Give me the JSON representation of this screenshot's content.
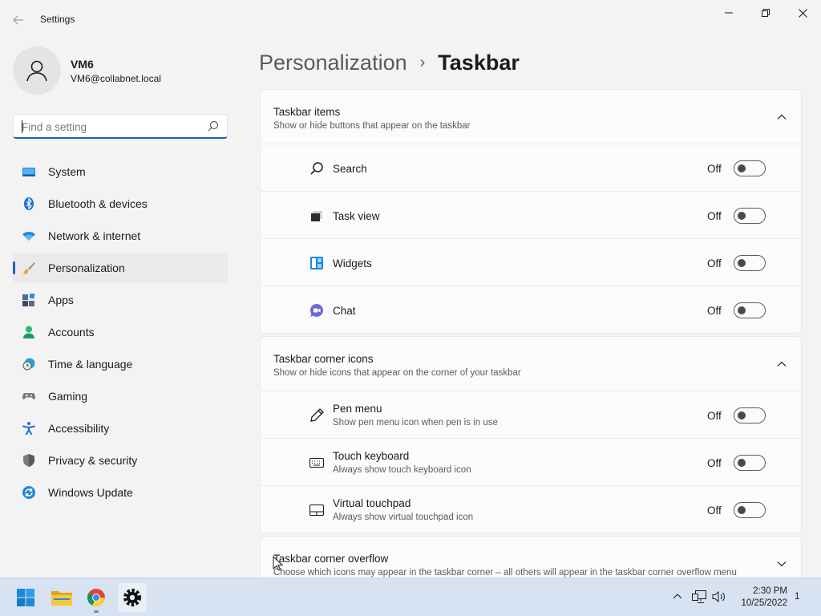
{
  "window": {
    "app_title": "Settings",
    "back_icon": "back-arrow-icon",
    "controls": [
      "minimize-icon",
      "maximize-icon",
      "close-icon"
    ]
  },
  "profile": {
    "name": "VM6",
    "email": "VM6@collabnet.local"
  },
  "search": {
    "placeholder": "Find a setting",
    "value": ""
  },
  "sidebar": {
    "items": [
      {
        "label": "System",
        "icon": "system-icon"
      },
      {
        "label": "Bluetooth & devices",
        "icon": "bluetooth-icon"
      },
      {
        "label": "Network & internet",
        "icon": "wifi-icon"
      },
      {
        "label": "Personalization",
        "icon": "brush-icon",
        "selected": true
      },
      {
        "label": "Apps",
        "icon": "apps-icon"
      },
      {
        "label": "Accounts",
        "icon": "accounts-icon"
      },
      {
        "label": "Time & language",
        "icon": "clock-globe-icon"
      },
      {
        "label": "Gaming",
        "icon": "gamepad-icon"
      },
      {
        "label": "Accessibility",
        "icon": "accessibility-icon"
      },
      {
        "label": "Privacy & security",
        "icon": "shield-icon"
      },
      {
        "label": "Windows Update",
        "icon": "update-icon"
      }
    ]
  },
  "breadcrumb": {
    "parent": "Personalization",
    "separator": "›",
    "current": "Taskbar"
  },
  "sections": {
    "taskbar_items": {
      "title": "Taskbar items",
      "description": "Show or hide buttons that appear on the taskbar",
      "expanded": true,
      "rows": [
        {
          "label": "Search",
          "state": "Off",
          "icon": "search-icon"
        },
        {
          "label": "Task view",
          "state": "Off",
          "icon": "task-view-icon"
        },
        {
          "label": "Widgets",
          "state": "Off",
          "icon": "widgets-icon"
        },
        {
          "label": "Chat",
          "state": "Off",
          "icon": "chat-icon"
        }
      ]
    },
    "corner_icons": {
      "title": "Taskbar corner icons",
      "description": "Show or hide icons that appear on the corner of your taskbar",
      "expanded": true,
      "rows": [
        {
          "label": "Pen menu",
          "sub": "Show pen menu icon when pen is in use",
          "state": "Off",
          "icon": "pen-icon"
        },
        {
          "label": "Touch keyboard",
          "sub": "Always show touch keyboard icon",
          "state": "Off",
          "icon": "keyboard-icon"
        },
        {
          "label": "Virtual touchpad",
          "sub": "Always show virtual touchpad icon",
          "state": "Off",
          "icon": "touchpad-icon"
        }
      ]
    },
    "corner_overflow": {
      "title": "Taskbar corner overflow",
      "description": "Choose which icons may appear in the taskbar corner – all others will appear in the taskbar corner overflow menu",
      "expanded": false
    }
  },
  "taskbar": {
    "apps": [
      "start-icon",
      "file-explorer-icon",
      "chrome-icon",
      "settings-gear-icon"
    ],
    "tray": [
      "chevron-up-icon",
      "network-icon",
      "volume-icon"
    ],
    "time": "2:30 PM",
    "date": "10/25/2022",
    "notifications": "1"
  },
  "colors": {
    "accent": "#1f5fbf",
    "taskbar": "#d7e2f2",
    "background": "#f3f3f3"
  }
}
